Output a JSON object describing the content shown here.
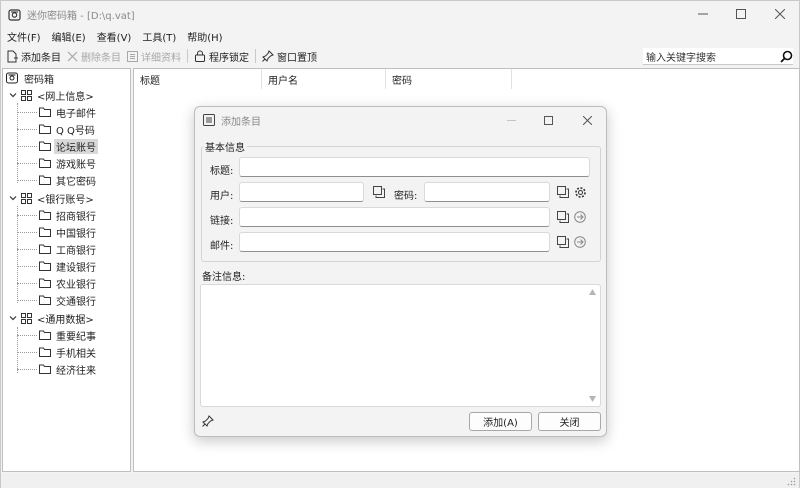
{
  "window": {
    "title": "迷你密码箱 - [D:\\q.vat]",
    "controls": {
      "minimize": "—",
      "maximize": "☐",
      "close": "✕"
    }
  },
  "menu": [
    "文件(F)",
    "编辑(E)",
    "查看(V)",
    "工具(T)",
    "帮助(H)"
  ],
  "toolbar": {
    "add": "添加条目",
    "delete": "删除条目",
    "details": "详细资料",
    "lock": "程序锁定",
    "pin": "窗口置顶",
    "search_placeholder": "输入关键字搜索"
  },
  "tree": {
    "root": "密码箱",
    "groups": [
      {
        "label": "<网上信息>",
        "children": [
          "电子邮件",
          "Q Q号码",
          "论坛账号",
          "游戏账号",
          "其它密码"
        ]
      },
      {
        "label": "<银行账号>",
        "children": [
          "招商银行",
          "中国银行",
          "工商银行",
          "建设银行",
          "农业银行",
          "交通银行"
        ]
      },
      {
        "label": "<通用数据>",
        "children": [
          "重要纪事",
          "手机相关",
          "经济往来"
        ]
      }
    ],
    "selected": "论坛账号"
  },
  "list": {
    "columns": [
      "标题",
      "用户名",
      "密码"
    ]
  },
  "dialog": {
    "title": "添加条目",
    "group_title": "基本信息",
    "labels": {
      "title": "标题:",
      "user": "用户:",
      "password": "密码:",
      "link": "链接:",
      "email": "邮件:"
    },
    "notes_label": "备注信息:",
    "buttons": {
      "add": "添加(A)",
      "close": "关闭"
    }
  }
}
